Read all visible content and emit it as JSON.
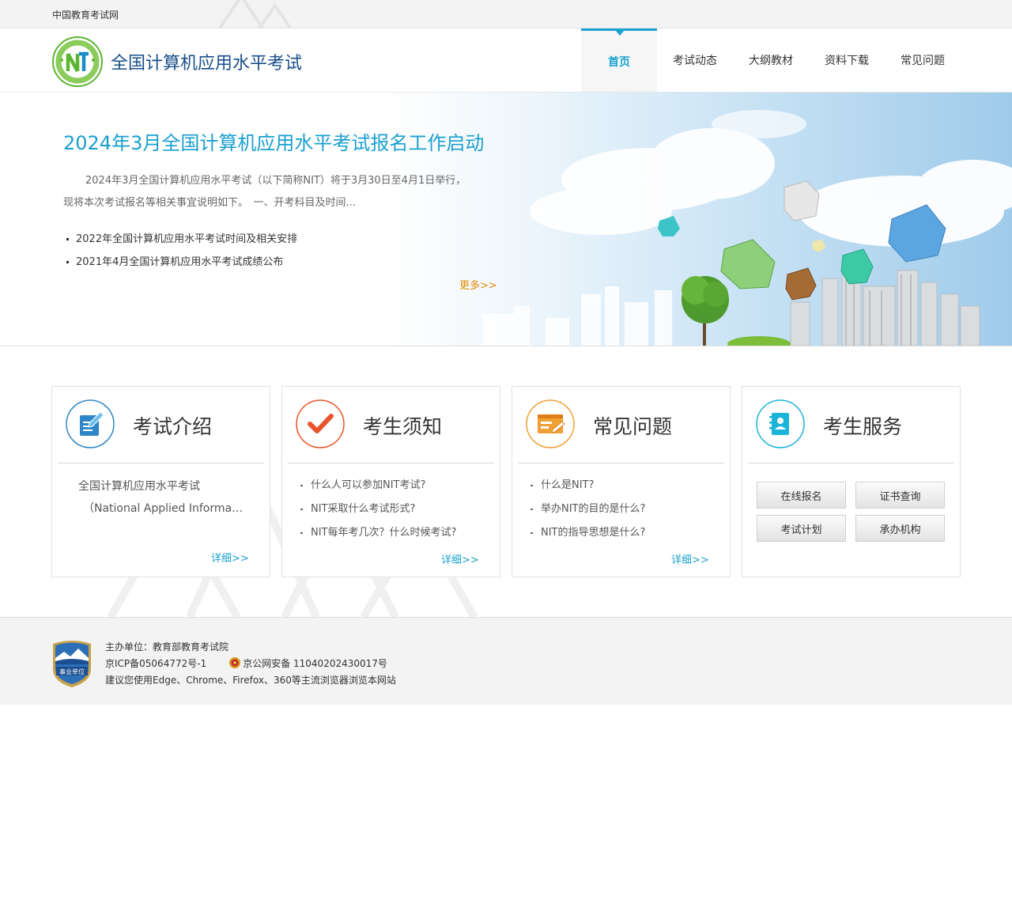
{
  "topbar": {
    "label": "中国教育考试网"
  },
  "header": {
    "title": "全国计算机应用水平考试",
    "nav": [
      {
        "label": "首页",
        "active": true
      },
      {
        "label": "考试动态",
        "active": false
      },
      {
        "label": "大纲教材",
        "active": false
      },
      {
        "label": "资料下载",
        "active": false
      },
      {
        "label": "常见问题",
        "active": false
      }
    ]
  },
  "banner": {
    "title": "2024年3月全国计算机应用水平考试报名工作启动",
    "summary": "2024年3月全国计算机应用水平考试（以下简称NIT）将于3月30日至4月1日举行，现将本次考试报名等相关事宜说明如下。　一、开考科目及时间...",
    "news": [
      "2022年全国计算机应用水平考试时间及相关安排",
      "2021年4月全国计算机应用水平考试成绩公布"
    ],
    "more": "更多>>"
  },
  "cards": {
    "intro": {
      "title": "考试介绍",
      "line1": "全国计算机应用水平考试",
      "line2": "（National Applied Information Technology Certificate）",
      "more": "详细>>"
    },
    "notice": {
      "title": "考生须知",
      "items": [
        "什么人可以参加NIT考试?",
        "NIT采取什么考试形式?",
        "NIT每年考几次？什么时候考试?"
      ],
      "more": "详细>>"
    },
    "faq": {
      "title": "常见问题",
      "items": [
        "什么是NIT?",
        "举办NIT的目的是什么?",
        "NIT的指导思想是什么?"
      ],
      "more": "详细>>"
    },
    "service": {
      "title": "考生服务",
      "buttons": [
        "在线报名",
        "证书查询",
        "考试计划",
        "承办机构"
      ]
    }
  },
  "footer": {
    "sponsor": "主办单位：教育部教育考试院",
    "icp": "京ICP备05064772号-1",
    "police": "京公网安备 11040202430017号",
    "browser_tip": "建议您使用Edge、Chrome、Firefox、360等主流浏览器浏览本网站",
    "badge_text": "事业单位"
  },
  "colors": {
    "accent": "#19a3d0",
    "title_blue": "#1a4f8b",
    "more_orange": "#e38a00",
    "logo_green": "#5cb531"
  }
}
